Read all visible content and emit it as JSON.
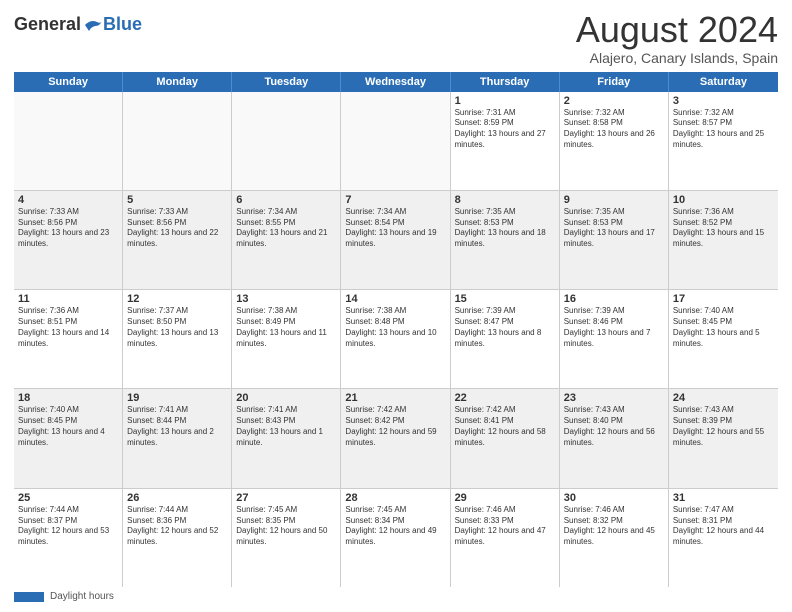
{
  "logo": {
    "general": "General",
    "blue": "Blue"
  },
  "title": {
    "month_year": "August 2024",
    "location": "Alajero, Canary Islands, Spain"
  },
  "header_days": [
    "Sunday",
    "Monday",
    "Tuesday",
    "Wednesday",
    "Thursday",
    "Friday",
    "Saturday"
  ],
  "footer": {
    "legend_label": "Daylight hours"
  },
  "weeks": [
    [
      {
        "day": "",
        "sunrise": "",
        "sunset": "",
        "daylight": "",
        "empty": true
      },
      {
        "day": "",
        "sunrise": "",
        "sunset": "",
        "daylight": "",
        "empty": true
      },
      {
        "day": "",
        "sunrise": "",
        "sunset": "",
        "daylight": "",
        "empty": true
      },
      {
        "day": "",
        "sunrise": "",
        "sunset": "",
        "daylight": "",
        "empty": true
      },
      {
        "day": "1",
        "sunrise": "Sunrise: 7:31 AM",
        "sunset": "Sunset: 8:59 PM",
        "daylight": "Daylight: 13 hours and 27 minutes."
      },
      {
        "day": "2",
        "sunrise": "Sunrise: 7:32 AM",
        "sunset": "Sunset: 8:58 PM",
        "daylight": "Daylight: 13 hours and 26 minutes."
      },
      {
        "day": "3",
        "sunrise": "Sunrise: 7:32 AM",
        "sunset": "Sunset: 8:57 PM",
        "daylight": "Daylight: 13 hours and 25 minutes."
      }
    ],
    [
      {
        "day": "4",
        "sunrise": "Sunrise: 7:33 AM",
        "sunset": "Sunset: 8:56 PM",
        "daylight": "Daylight: 13 hours and 23 minutes."
      },
      {
        "day": "5",
        "sunrise": "Sunrise: 7:33 AM",
        "sunset": "Sunset: 8:56 PM",
        "daylight": "Daylight: 13 hours and 22 minutes."
      },
      {
        "day": "6",
        "sunrise": "Sunrise: 7:34 AM",
        "sunset": "Sunset: 8:55 PM",
        "daylight": "Daylight: 13 hours and 21 minutes."
      },
      {
        "day": "7",
        "sunrise": "Sunrise: 7:34 AM",
        "sunset": "Sunset: 8:54 PM",
        "daylight": "Daylight: 13 hours and 19 minutes."
      },
      {
        "day": "8",
        "sunrise": "Sunrise: 7:35 AM",
        "sunset": "Sunset: 8:53 PM",
        "daylight": "Daylight: 13 hours and 18 minutes."
      },
      {
        "day": "9",
        "sunrise": "Sunrise: 7:35 AM",
        "sunset": "Sunset: 8:53 PM",
        "daylight": "Daylight: 13 hours and 17 minutes."
      },
      {
        "day": "10",
        "sunrise": "Sunrise: 7:36 AM",
        "sunset": "Sunset: 8:52 PM",
        "daylight": "Daylight: 13 hours and 15 minutes."
      }
    ],
    [
      {
        "day": "11",
        "sunrise": "Sunrise: 7:36 AM",
        "sunset": "Sunset: 8:51 PM",
        "daylight": "Daylight: 13 hours and 14 minutes."
      },
      {
        "day": "12",
        "sunrise": "Sunrise: 7:37 AM",
        "sunset": "Sunset: 8:50 PM",
        "daylight": "Daylight: 13 hours and 13 minutes."
      },
      {
        "day": "13",
        "sunrise": "Sunrise: 7:38 AM",
        "sunset": "Sunset: 8:49 PM",
        "daylight": "Daylight: 13 hours and 11 minutes."
      },
      {
        "day": "14",
        "sunrise": "Sunrise: 7:38 AM",
        "sunset": "Sunset: 8:48 PM",
        "daylight": "Daylight: 13 hours and 10 minutes."
      },
      {
        "day": "15",
        "sunrise": "Sunrise: 7:39 AM",
        "sunset": "Sunset: 8:47 PM",
        "daylight": "Daylight: 13 hours and 8 minutes."
      },
      {
        "day": "16",
        "sunrise": "Sunrise: 7:39 AM",
        "sunset": "Sunset: 8:46 PM",
        "daylight": "Daylight: 13 hours and 7 minutes."
      },
      {
        "day": "17",
        "sunrise": "Sunrise: 7:40 AM",
        "sunset": "Sunset: 8:45 PM",
        "daylight": "Daylight: 13 hours and 5 minutes."
      }
    ],
    [
      {
        "day": "18",
        "sunrise": "Sunrise: 7:40 AM",
        "sunset": "Sunset: 8:45 PM",
        "daylight": "Daylight: 13 hours and 4 minutes."
      },
      {
        "day": "19",
        "sunrise": "Sunrise: 7:41 AM",
        "sunset": "Sunset: 8:44 PM",
        "daylight": "Daylight: 13 hours and 2 minutes."
      },
      {
        "day": "20",
        "sunrise": "Sunrise: 7:41 AM",
        "sunset": "Sunset: 8:43 PM",
        "daylight": "Daylight: 13 hours and 1 minute."
      },
      {
        "day": "21",
        "sunrise": "Sunrise: 7:42 AM",
        "sunset": "Sunset: 8:42 PM",
        "daylight": "Daylight: 12 hours and 59 minutes."
      },
      {
        "day": "22",
        "sunrise": "Sunrise: 7:42 AM",
        "sunset": "Sunset: 8:41 PM",
        "daylight": "Daylight: 12 hours and 58 minutes."
      },
      {
        "day": "23",
        "sunrise": "Sunrise: 7:43 AM",
        "sunset": "Sunset: 8:40 PM",
        "daylight": "Daylight: 12 hours and 56 minutes."
      },
      {
        "day": "24",
        "sunrise": "Sunrise: 7:43 AM",
        "sunset": "Sunset: 8:39 PM",
        "daylight": "Daylight: 12 hours and 55 minutes."
      }
    ],
    [
      {
        "day": "25",
        "sunrise": "Sunrise: 7:44 AM",
        "sunset": "Sunset: 8:37 PM",
        "daylight": "Daylight: 12 hours and 53 minutes."
      },
      {
        "day": "26",
        "sunrise": "Sunrise: 7:44 AM",
        "sunset": "Sunset: 8:36 PM",
        "daylight": "Daylight: 12 hours and 52 minutes."
      },
      {
        "day": "27",
        "sunrise": "Sunrise: 7:45 AM",
        "sunset": "Sunset: 8:35 PM",
        "daylight": "Daylight: 12 hours and 50 minutes."
      },
      {
        "day": "28",
        "sunrise": "Sunrise: 7:45 AM",
        "sunset": "Sunset: 8:34 PM",
        "daylight": "Daylight: 12 hours and 49 minutes."
      },
      {
        "day": "29",
        "sunrise": "Sunrise: 7:46 AM",
        "sunset": "Sunset: 8:33 PM",
        "daylight": "Daylight: 12 hours and 47 minutes."
      },
      {
        "day": "30",
        "sunrise": "Sunrise: 7:46 AM",
        "sunset": "Sunset: 8:32 PM",
        "daylight": "Daylight: 12 hours and 45 minutes."
      },
      {
        "day": "31",
        "sunrise": "Sunrise: 7:47 AM",
        "sunset": "Sunset: 8:31 PM",
        "daylight": "Daylight: 12 hours and 44 minutes."
      }
    ]
  ]
}
